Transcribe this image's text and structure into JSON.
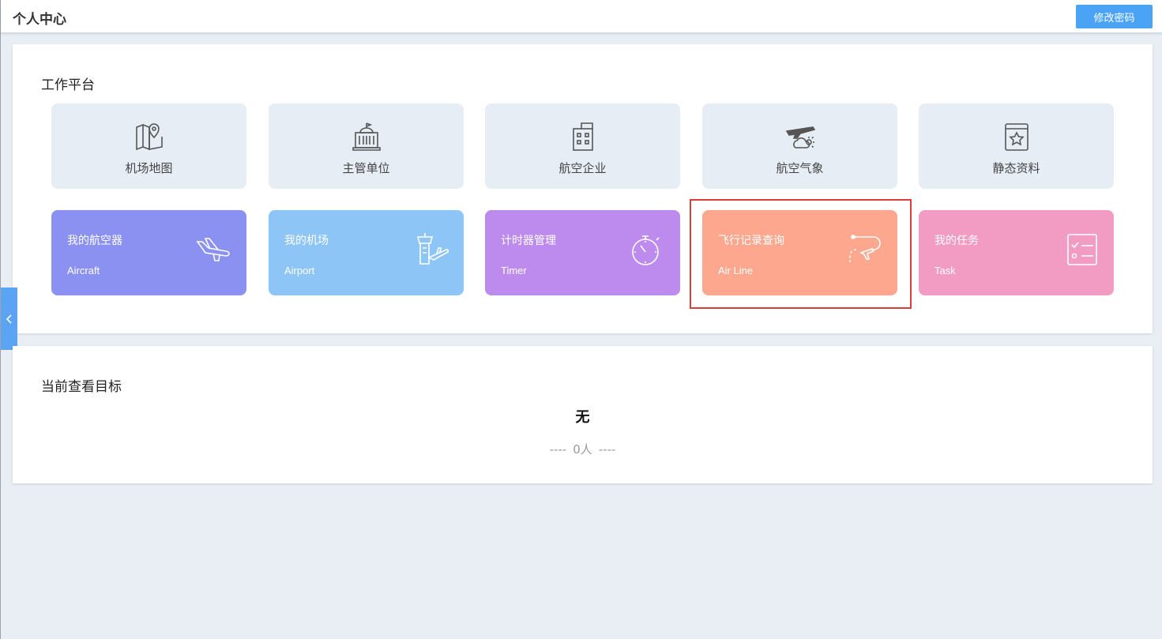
{
  "header": {
    "title": "个人中心",
    "change_password_label": "修改密码"
  },
  "workbench": {
    "heading": "工作平台",
    "grey_tiles": [
      {
        "label": "机场地图",
        "icon": "map-pin-icon"
      },
      {
        "label": "主管单位",
        "icon": "government-building-icon"
      },
      {
        "label": "航空企业",
        "icon": "office-building-icon"
      },
      {
        "label": "航空气象",
        "icon": "plane-weather-icon"
      },
      {
        "label": "静态资料",
        "icon": "star-book-icon"
      }
    ],
    "color_tiles": [
      {
        "cn": "我的航空器",
        "en": "Aircraft",
        "icon": "airplane-icon",
        "color": "#8b91f0"
      },
      {
        "cn": "我的机场",
        "en": "Airport",
        "icon": "control-tower-icon",
        "color": "#8ec5f7"
      },
      {
        "cn": "计时器管理",
        "en": "Timer",
        "icon": "stopwatch-icon",
        "color": "#bd8bed"
      },
      {
        "cn": "飞行记录查询",
        "en": "Air Line",
        "icon": "flight-route-icon",
        "color": "#fea78f"
      },
      {
        "cn": "我的任务",
        "en": "Task",
        "icon": "task-list-icon",
        "color": "#f29cc3"
      }
    ]
  },
  "target": {
    "heading": "当前查看目标",
    "name": "无",
    "count_dash_left": "----",
    "count": "0人",
    "count_dash_right": "----"
  },
  "colors": {
    "accent_blue": "#4aa3f5",
    "highlight_red": "#d9403a"
  }
}
